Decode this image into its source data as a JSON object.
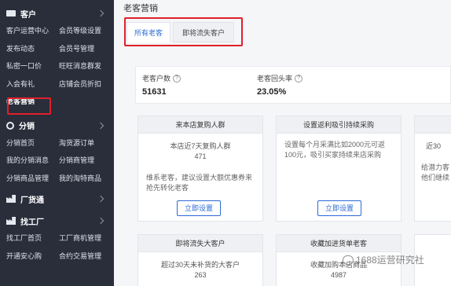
{
  "sidebar": {
    "sections": [
      {
        "title": "客户",
        "items": [
          "客户运营中心",
          "会员等级设置",
          "发布动态",
          "会员号管理",
          "私密一口价",
          "旺旺消息群发",
          "入会有礼",
          "店铺会员折扣",
          "老客营销"
        ]
      },
      {
        "title": "分销",
        "items": [
          "分销首页",
          "淘货源订单",
          "我的分销消息",
          "分销商管理",
          "分销商品管理",
          "我的淘特商品"
        ]
      },
      {
        "title": "厂货通",
        "items": []
      },
      {
        "title": "找工厂",
        "items": [
          "找工厂首页",
          "工厂商机管理",
          "开通安心购",
          "合约交易管理"
        ]
      }
    ],
    "active_item": "老客营销"
  },
  "page": {
    "title": "老客营销"
  },
  "tabs": [
    {
      "label": "所有老客",
      "selected": true
    },
    {
      "label": "即将流失客户",
      "selected": false
    }
  ],
  "stats": [
    {
      "label": "老客户数",
      "value": "51631"
    },
    {
      "label": "老客回头率",
      "value": "23.05%"
    }
  ],
  "cards_row1": [
    {
      "title": "来本店复购人群",
      "line1": "本店近7天复购人群",
      "line2": "471",
      "desc": "维系老客，建议设置大额优惠券来抢先转化老客",
      "button": "立即设置"
    },
    {
      "title": "设置返利吸引持续采购",
      "line1": "",
      "line2": "",
      "desc": "设置每个月采满比如2000元可返100元，吸引买家持续来店采购",
      "button": "立即设置"
    },
    {
      "title": "",
      "line1": "近30",
      "line2": "",
      "desc": "给潜力客他们继续",
      "button": ""
    }
  ],
  "cards_row2": [
    {
      "title": "即将流失大客户",
      "line1": "超过30天未补货的大客户",
      "line2": "263"
    },
    {
      "title": "收藏加进货单老客",
      "line1": "收藏加购本店商品",
      "line2": "4987"
    }
  ],
  "watermark": "1688运营研究社",
  "colors": {
    "sidebar_bg": "#2a2e3b",
    "accent": "#2d6bd6",
    "highlight": "#e0202a"
  }
}
